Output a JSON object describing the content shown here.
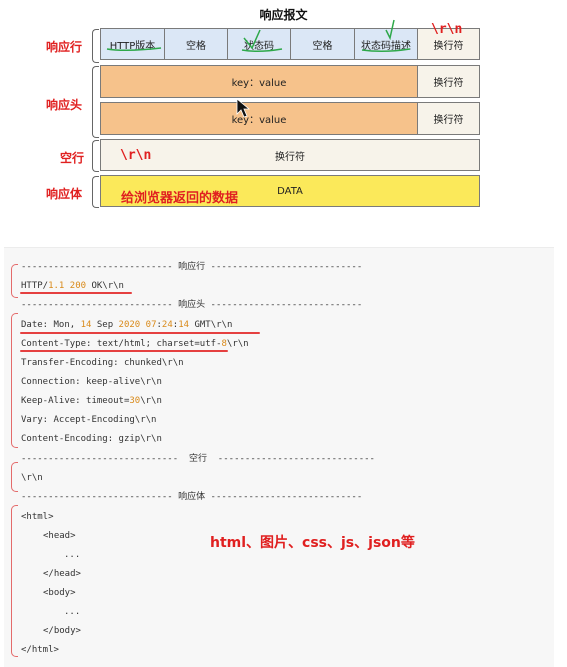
{
  "diagram": {
    "title": "响应报文",
    "status_line": {
      "label": "响应行",
      "cells": [
        "HTTP版本",
        "空格",
        "状态码",
        "空格",
        "状态码描述",
        "换行符"
      ],
      "crlf_note": "\\r\\n"
    },
    "headers": {
      "label": "响应头",
      "rows": [
        {
          "field": "key：value",
          "end": "换行符"
        },
        {
          "field": "key：value",
          "end": "换行符"
        }
      ]
    },
    "blank_line": {
      "label": "空行",
      "crlf_note": "\\r\\n",
      "cell": "换行符"
    },
    "body": {
      "label": "响应体",
      "note": "给浏览器返回的数据",
      "cell": "DATA"
    }
  },
  "code": {
    "sections": {
      "status": "---------------------------- 响应行 ----------------------------",
      "headers": "---------------------------- 响应头 ----------------------------",
      "blank": "-----------------------------  空行  -----------------------------",
      "body": "---------------------------- 响应体 ----------------------------"
    },
    "status_line": {
      "proto": "HTTP/",
      "version": "1.1",
      "sp": " ",
      "code": "200",
      "rest": " OK\\r\\n"
    },
    "date_line": {
      "a": "Date: Mon, ",
      "day": "14",
      "b": " Sep ",
      "year": "2020",
      "c": " ",
      "h": "07",
      "d": ":",
      "m": "24",
      "e": ":",
      "s": "14",
      "f": " GMT\\r\\n"
    },
    "content_type": {
      "a": "Content-Type: text/html; charset=utf-",
      "n": "8",
      "b": "\\r\\n"
    },
    "transfer_encoding": "Transfer-Encoding: chunked\\r\\n",
    "connection": "Connection: keep-alive\\r\\n",
    "keep_alive": {
      "a": "Keep-Alive: timeout=",
      "n": "30",
      "b": "\\r\\n"
    },
    "vary": "Vary: Accept-Encoding\\r\\n",
    "content_encoding": "Content-Encoding: gzip\\r\\n",
    "blank_crlf": "\\r\\n",
    "html_lines": [
      "<html>",
      "<head>",
      "...",
      "</head>",
      "<body>",
      "...",
      "</body>",
      "</html>"
    ],
    "body_note": "html、图片、css、js、json等"
  },
  "colors": {
    "accent_red": "#e02020",
    "number_orange": "#d98a1a",
    "status_blue": "#dbe7f6",
    "header_orange": "#f6c28b",
    "body_yellow": "#fbe95a"
  }
}
